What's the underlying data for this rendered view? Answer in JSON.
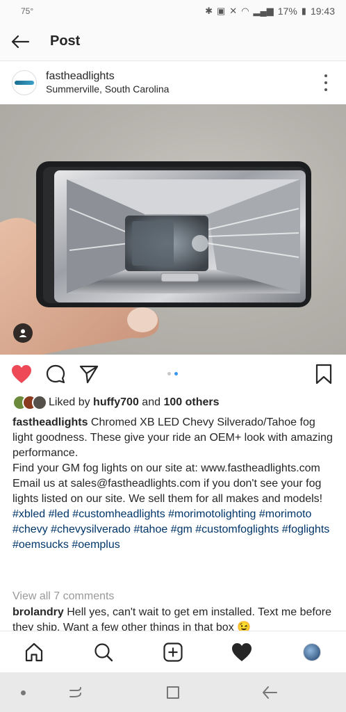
{
  "status_bar": {
    "temperature": "75°",
    "battery": "17%",
    "time": "19:43"
  },
  "header": {
    "title": "Post"
  },
  "post": {
    "username": "fastheadlights",
    "location": "Summerville, South Carolina",
    "carousel": {
      "total": 2,
      "active": 2
    },
    "likes": {
      "prefix": "Liked by",
      "user": "huffy700",
      "joiner": "and",
      "others": "100 others"
    },
    "caption": {
      "user": "fastheadlights",
      "line1": "Chromed XB LED Chevy Silverado/Tahoe fog light goodness.  These give your ride an OEM+ look with amazing performance.",
      "line2": "Find your GM fog lights on our site at: www.fastheadlights.com",
      "line3": "Email us at sales@fastheadlights.com if you don't see your fog lights listed on our site. We sell them for all makes and models!",
      "hashtags": "#xbled #led #customheadlights #morimotolighting #morimoto #chevy #chevysilverado #tahoe #gm #customfoglights #foglights #oemsucks #oemplus"
    },
    "view_comments": "View all 7 comments",
    "comment": {
      "user": "brolandry",
      "text": "Hell yes, can't wait to get em installed. Text me before they ship.  Want a few other things in that box 😉"
    }
  },
  "icons": {
    "back": "arrow-left-icon",
    "more": "more-vertical-icon",
    "like": "heart-icon",
    "comment": "comment-icon",
    "share": "send-icon",
    "save": "bookmark-icon",
    "home": "home-icon",
    "search": "search-icon",
    "add": "add-post-icon",
    "activity": "heart-icon",
    "profile": "profile-avatar"
  },
  "colors": {
    "like_red": "#ed4956",
    "hashtag_blue": "#003569",
    "carousel_active": "#3897f0",
    "muted_text": "#999999"
  }
}
